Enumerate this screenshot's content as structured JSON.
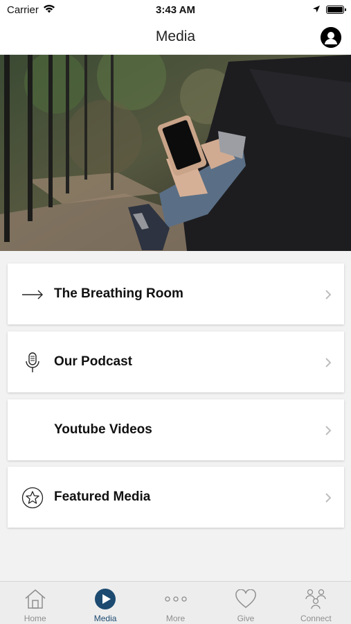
{
  "status_bar": {
    "carrier": "Carrier",
    "time": "3:43 AM",
    "icons": [
      "wifi-icon",
      "location-arrow-icon",
      "battery-icon"
    ]
  },
  "nav": {
    "title": "Media",
    "profile_icon": "profile-icon"
  },
  "hero": {
    "image_description_icon": "hero-photo"
  },
  "menu": {
    "items": [
      {
        "label": "The Breathing Room",
        "icon": "arrow-right-icon"
      },
      {
        "label": "Our Podcast",
        "icon": "microphone-icon"
      },
      {
        "label": "Youtube Videos",
        "icon": ""
      },
      {
        "label": "Featured Media",
        "icon": "star-circle-icon"
      }
    ]
  },
  "tabs": {
    "items": [
      {
        "label": "Home",
        "icon": "home-icon"
      },
      {
        "label": "Media",
        "icon": "play-circle-icon",
        "active": true
      },
      {
        "label": "More",
        "icon": "more-dots-icon"
      },
      {
        "label": "Give",
        "icon": "heart-icon"
      },
      {
        "label": "Connect",
        "icon": "people-icon"
      }
    ]
  },
  "colors": {
    "accent": "#1c4a70",
    "inactive": "#8e8e8e",
    "background": "#f2f2f2"
  }
}
